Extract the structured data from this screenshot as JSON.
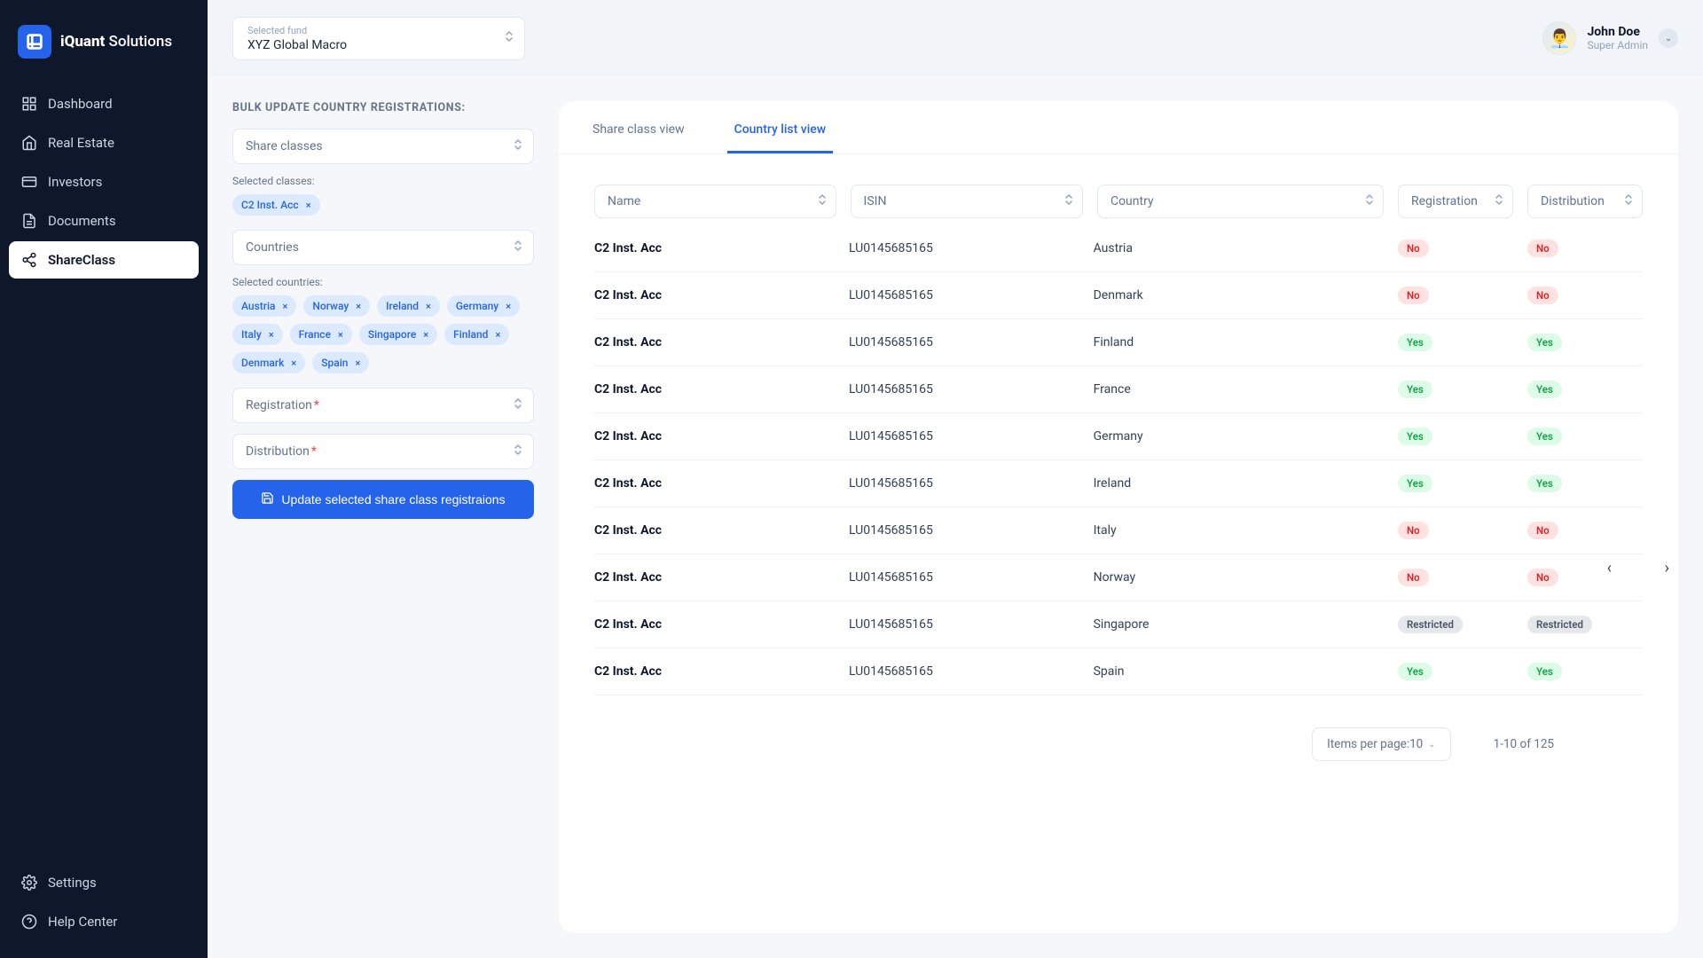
{
  "brand": {
    "strong": "iQuant",
    "light": " Solutions"
  },
  "sidebar": {
    "items": [
      {
        "label": "Dashboard",
        "icon": "dashboard-icon"
      },
      {
        "label": "Real Estate",
        "icon": "home-icon"
      },
      {
        "label": "Investors",
        "icon": "card-icon"
      },
      {
        "label": "Documents",
        "icon": "document-icon"
      },
      {
        "label": "ShareClass",
        "icon": "share-icon",
        "active": true
      }
    ],
    "bottom": [
      {
        "label": "Settings",
        "icon": "gear-icon"
      },
      {
        "label": "Help Center",
        "icon": "help-icon"
      }
    ]
  },
  "topbar": {
    "fund_label": "Selected fund",
    "fund_value": "XYZ Global Macro",
    "user_name": "John Doe",
    "user_role": "Super Admin"
  },
  "form": {
    "title": "BULK UPDATE COUNTRY REGISTRATIONS:",
    "share_classes_placeholder": "Share classes",
    "selected_classes_label": "Selected classes:",
    "selected_classes": [
      "C2 Inst. Acc"
    ],
    "countries_placeholder": "Countries",
    "selected_countries_label": "Selected countries:",
    "selected_countries": [
      "Austria",
      "Norway",
      "Ireland",
      "Germany",
      "Italy",
      "France",
      "Singapore",
      "Finland",
      "Denmark",
      "Spain"
    ],
    "registration_placeholder": "Registration",
    "distribution_placeholder": "Distribution",
    "cta_label": "Update selected share class registraions"
  },
  "tabs": {
    "share_class_view": "Share class view",
    "country_list_view": "Country list view"
  },
  "filters": {
    "name": "Name",
    "isin": "ISIN",
    "country": "Country",
    "registration": "Registration",
    "distribution": "Distribution"
  },
  "rows": [
    {
      "name": "C2 Inst. Acc",
      "isin": "LU0145685165",
      "country": "Austria",
      "reg": "No",
      "dist": "No"
    },
    {
      "name": "C2 Inst. Acc",
      "isin": "LU0145685165",
      "country": "Denmark",
      "reg": "No",
      "dist": "No"
    },
    {
      "name": "C2 Inst. Acc",
      "isin": "LU0145685165",
      "country": "Finland",
      "reg": "Yes",
      "dist": "Yes"
    },
    {
      "name": "C2 Inst. Acc",
      "isin": "LU0145685165",
      "country": "France",
      "reg": "Yes",
      "dist": "Yes"
    },
    {
      "name": "C2 Inst. Acc",
      "isin": "LU0145685165",
      "country": "Germany",
      "reg": "Yes",
      "dist": "Yes"
    },
    {
      "name": "C2 Inst. Acc",
      "isin": "LU0145685165",
      "country": "Ireland",
      "reg": "Yes",
      "dist": "Yes"
    },
    {
      "name": "C2 Inst. Acc",
      "isin": "LU0145685165",
      "country": "Italy",
      "reg": "No",
      "dist": "No"
    },
    {
      "name": "C2 Inst. Acc",
      "isin": "LU0145685165",
      "country": "Norway",
      "reg": "No",
      "dist": "No"
    },
    {
      "name": "C2 Inst. Acc",
      "isin": "LU0145685165",
      "country": "Singapore",
      "reg": "Restricted",
      "dist": "Restricted"
    },
    {
      "name": "C2 Inst. Acc",
      "isin": "LU0145685165",
      "country": "Spain",
      "reg": "Yes",
      "dist": "Yes"
    }
  ],
  "pager": {
    "items_per_page_label": "Items per page:",
    "items_per_page_value": "10",
    "range_text": "1-10 of 125"
  }
}
